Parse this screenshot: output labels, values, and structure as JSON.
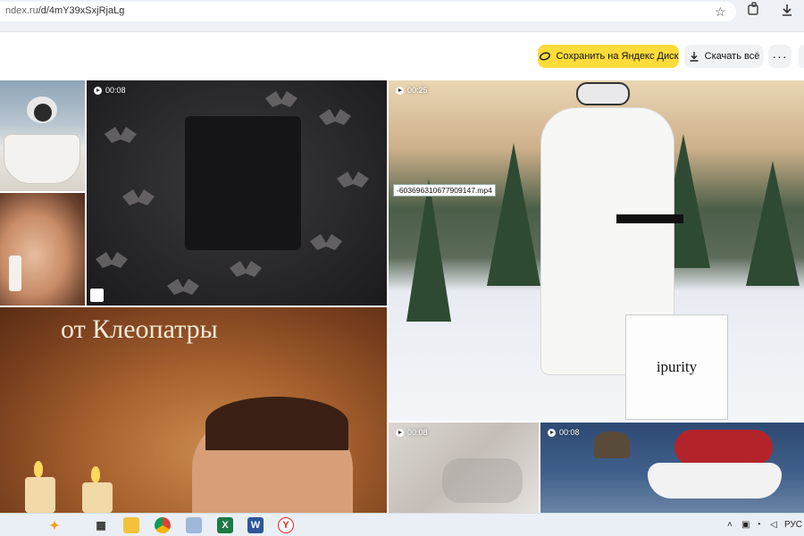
{
  "browser": {
    "url_host": "ndex.ru",
    "url_path": "/d/4mY39xSxjRjaLg"
  },
  "header": {
    "save_label": "Сохранить на Яндекс Диск",
    "download_label": "Скачать всё",
    "more_label": "···"
  },
  "tiles": {
    "bats_duration": "00:08",
    "ski_duration": "00:25",
    "ski_tooltip": "-603696310677909147.mp4",
    "ski_bag_text": "ipurity",
    "cleo_text": "от Клеопатры",
    "hands_duration": "00:08",
    "sleigh_duration": "00:08"
  },
  "taskbar": {
    "language": "РУС",
    "apps": [
      "copilot-icon",
      "task-view-icon",
      "file-explorer-icon",
      "chrome-icon",
      "paint-icon",
      "excel-icon",
      "word-icon",
      "yandex-browser-icon"
    ]
  },
  "colors": {
    "accent_yellow": "#ffdc3a",
    "button_grey": "#f1f2f4"
  }
}
